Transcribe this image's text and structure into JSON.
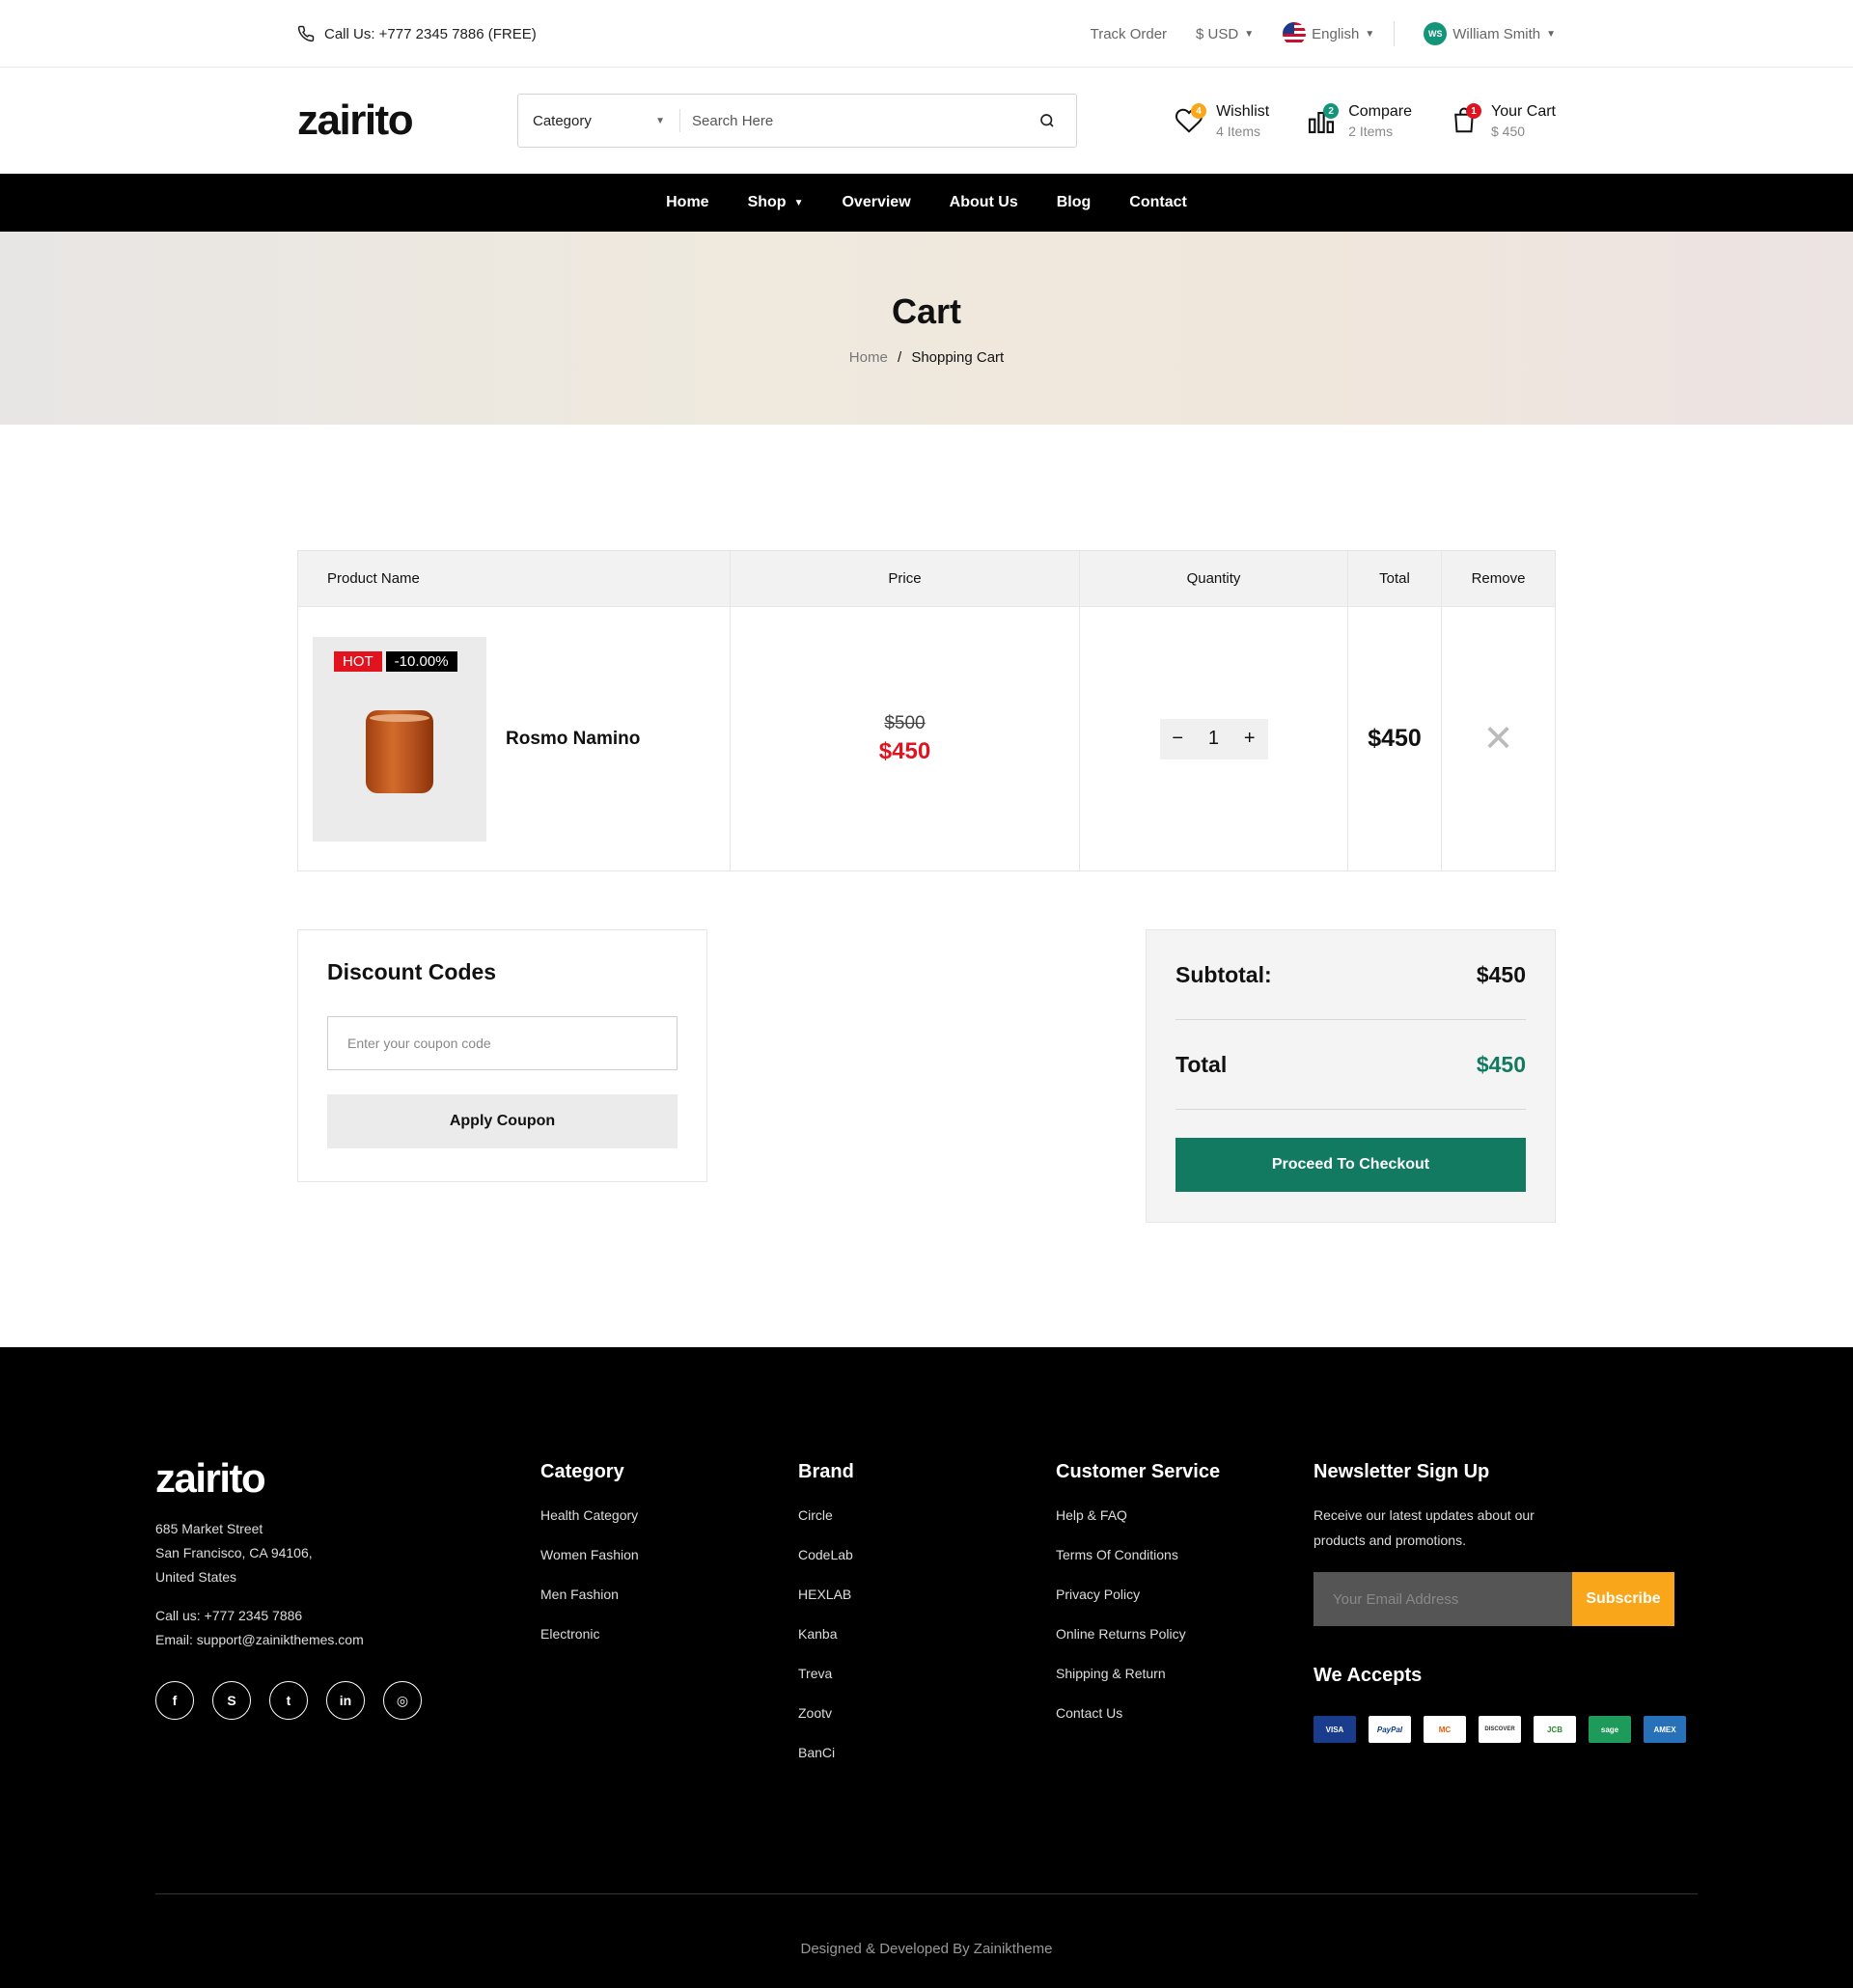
{
  "topbar": {
    "call": "Call Us: +777 2345 7886 (FREE)",
    "track": "Track Order",
    "currency": "$ USD",
    "language": "English",
    "user_initials": "WS",
    "user": "William Smith"
  },
  "header": {
    "logo": "zairito",
    "category": "Category",
    "search_placeholder": "Search Here",
    "wishlist": {
      "label": "Wishlist",
      "sub": "4 Items",
      "count": "4"
    },
    "compare": {
      "label": "Compare",
      "sub": "2 Items",
      "count": "2"
    },
    "cart": {
      "label": "Your Cart",
      "sub": "$ 450",
      "count": "1"
    }
  },
  "nav": [
    "Home",
    "Shop",
    "Overview",
    "About Us",
    "Blog",
    "Contact"
  ],
  "hero": {
    "title": "Cart",
    "crumb_home": "Home",
    "crumb_sep": "/",
    "crumb_current": "Shopping Cart"
  },
  "table": {
    "headers": [
      "Product Name",
      "Price",
      "Quantity",
      "Total",
      "Remove"
    ],
    "row": {
      "tag_hot": "HOT",
      "tag_discount": "-10.00%",
      "name": "Rosmo Namino",
      "old_price": "$500",
      "price": "$450",
      "qty": "1",
      "minus": "−",
      "plus": "+",
      "total": "$450",
      "remove": "✕"
    }
  },
  "discount": {
    "title": "Discount Codes",
    "placeholder": "Enter your coupon code",
    "button": "Apply Coupon"
  },
  "summary": {
    "subtotal_label": "Subtotal:",
    "subtotal": "$450",
    "total_label": "Total",
    "total": "$450",
    "checkout": "Proceed To Checkout"
  },
  "footer": {
    "logo": "zairito",
    "address": [
      "685 Market Street",
      "San Francisco, CA 94106,",
      "United States"
    ],
    "call": "Call us: +777 2345 7886",
    "email": "Email: support@zainikthemes.com",
    "social": [
      "f",
      "S",
      "t",
      "in",
      "◎"
    ],
    "category": {
      "title": "Category",
      "items": [
        "Health Category",
        "Women Fashion",
        "Men Fashion",
        "Electronic"
      ]
    },
    "brand": {
      "title": "Brand",
      "items": [
        "Circle",
        "CodeLab",
        "HEXLAB",
        "Kanba",
        "Treva",
        "Zootv",
        "BanCi"
      ]
    },
    "service": {
      "title": "Customer Service",
      "items": [
        "Help & FAQ",
        "Terms Of Conditions",
        "Privacy Policy",
        "Online Returns Policy",
        "Shipping & Return",
        "Contact Us"
      ]
    },
    "newsletter": {
      "title": "Newsletter Sign Up",
      "text1": "Receive our latest updates about our",
      "text2": "products and promotions.",
      "placeholder": "Your Email Address",
      "button": "Subscribe"
    },
    "accepts": {
      "title": "We Accepts",
      "cards": [
        "VISA",
        "PayPal",
        "MC",
        "DISCOVER",
        "JCB",
        "sage",
        "AMEX"
      ]
    },
    "copyright": "Designed & Developed By Zainiktheme"
  },
  "colors": {
    "accent": "#137a62",
    "sale": "#e0131f",
    "subscribe": "#f9a61a"
  }
}
